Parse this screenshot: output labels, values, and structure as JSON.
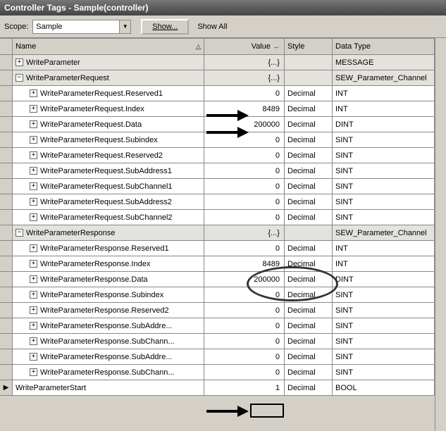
{
  "window": {
    "title": "Controller Tags - Sample(controller)"
  },
  "toolbar": {
    "scope_label": "Scope:",
    "scope_value": "Sample",
    "show_btn": "Show...",
    "showall": "Show All"
  },
  "columns": {
    "name": "Name",
    "value": "Value",
    "style": "Style",
    "datatype": "Data Type"
  },
  "rows": [
    {
      "exp": "+",
      "indent": 1,
      "name": "WriteParameter",
      "value": "{...}",
      "style": "",
      "type": "MESSAGE",
      "shaded": true
    },
    {
      "exp": "−",
      "indent": 1,
      "name": "WriteParameterRequest",
      "value": "{...}",
      "style": "",
      "type": "SEW_Parameter_Channel",
      "shaded": true
    },
    {
      "exp": "+",
      "indent": 2,
      "name": "WriteParameterRequest.Reserved1",
      "value": "0",
      "style": "Decimal",
      "type": "INT",
      "shaded": false
    },
    {
      "exp": "+",
      "indent": 2,
      "name": "WriteParameterRequest.Index",
      "value": "8489",
      "style": "Decimal",
      "type": "INT",
      "shaded": false
    },
    {
      "exp": "+",
      "indent": 2,
      "name": "WriteParameterRequest.Data",
      "value": "200000",
      "style": "Decimal",
      "type": "DINT",
      "shaded": false
    },
    {
      "exp": "+",
      "indent": 2,
      "name": "WriteParameterRequest.Subindex",
      "value": "0",
      "style": "Decimal",
      "type": "SINT",
      "shaded": false
    },
    {
      "exp": "+",
      "indent": 2,
      "name": "WriteParameterRequest.Reserved2",
      "value": "0",
      "style": "Decimal",
      "type": "SINT",
      "shaded": false
    },
    {
      "exp": "+",
      "indent": 2,
      "name": "WriteParameterRequest.SubAddress1",
      "value": "0",
      "style": "Decimal",
      "type": "SINT",
      "shaded": false
    },
    {
      "exp": "+",
      "indent": 2,
      "name": "WriteParameterRequest.SubChannel1",
      "value": "0",
      "style": "Decimal",
      "type": "SINT",
      "shaded": false
    },
    {
      "exp": "+",
      "indent": 2,
      "name": "WriteParameterRequest.SubAddress2",
      "value": "0",
      "style": "Decimal",
      "type": "SINT",
      "shaded": false
    },
    {
      "exp": "+",
      "indent": 2,
      "name": "WriteParameterRequest.SubChannel2",
      "value": "0",
      "style": "Decimal",
      "type": "SINT",
      "shaded": false
    },
    {
      "exp": "−",
      "indent": 1,
      "name": "WriteParameterResponse",
      "value": "{...}",
      "style": "",
      "type": "SEW_Parameter_Channel",
      "shaded": true
    },
    {
      "exp": "+",
      "indent": 2,
      "name": "WriteParameterResponse.Reserved1",
      "value": "0",
      "style": "Decimal",
      "type": "INT",
      "shaded": false
    },
    {
      "exp": "+",
      "indent": 2,
      "name": "WriteParameterResponse.Index",
      "value": "8489",
      "style": "Decimal",
      "type": "INT",
      "shaded": false
    },
    {
      "exp": "+",
      "indent": 2,
      "name": "WriteParameterResponse.Data",
      "value": "200000",
      "style": "Decimal",
      "type": "DINT",
      "shaded": false
    },
    {
      "exp": "+",
      "indent": 2,
      "name": "WriteParameterResponse.Subindex",
      "value": "0",
      "style": "Decimal",
      "type": "SINT",
      "shaded": false
    },
    {
      "exp": "+",
      "indent": 2,
      "name": "WriteParameterResponse.Reserved2",
      "value": "0",
      "style": "Decimal",
      "type": "SINT",
      "shaded": false
    },
    {
      "exp": "+",
      "indent": 2,
      "name": "WriteParameterResponse.SubAddre...",
      "value": "0",
      "style": "Decimal",
      "type": "SINT",
      "shaded": false
    },
    {
      "exp": "+",
      "indent": 2,
      "name": "WriteParameterResponse.SubChann...",
      "value": "0",
      "style": "Decimal",
      "type": "SINT",
      "shaded": false
    },
    {
      "exp": "+",
      "indent": 2,
      "name": "WriteParameterResponse.SubAddre...",
      "value": "0",
      "style": "Decimal",
      "type": "SINT",
      "shaded": false
    },
    {
      "exp": "+",
      "indent": 2,
      "name": "WriteParameterResponse.SubChann...",
      "value": "0",
      "style": "Decimal",
      "type": "SINT",
      "shaded": false
    },
    {
      "exp": "",
      "indent": 1,
      "name": "WriteParameterStart",
      "value": "1",
      "style": "Decimal",
      "type": "BOOL",
      "shaded": false,
      "cursor": true
    }
  ]
}
